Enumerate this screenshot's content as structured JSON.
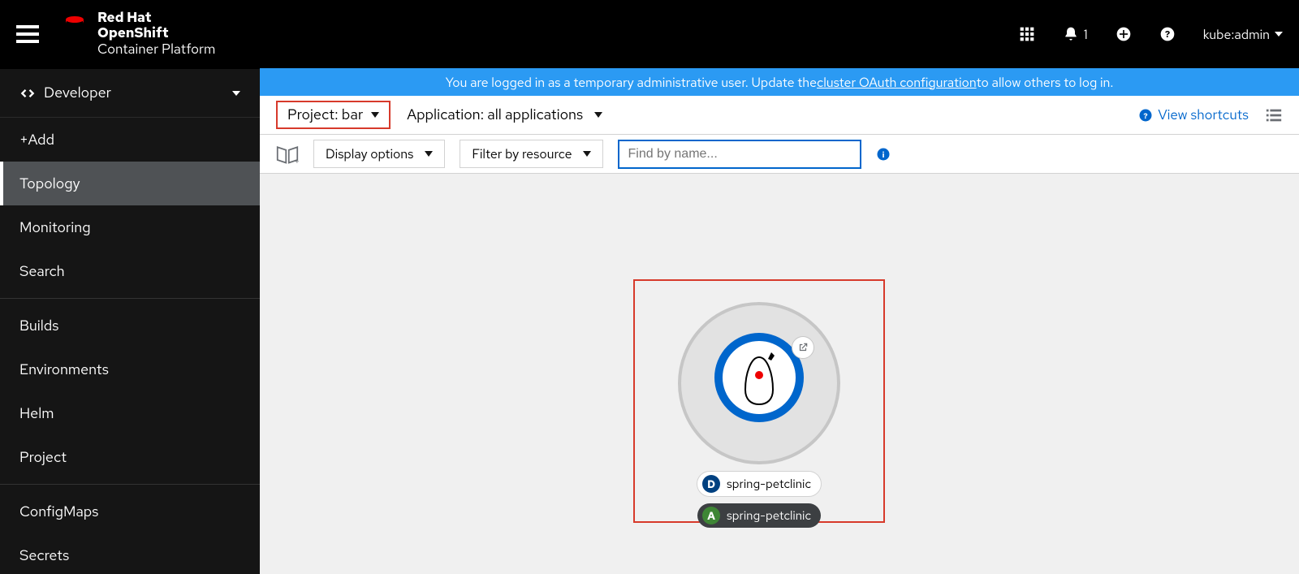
{
  "brand": {
    "line1": "Red Hat",
    "line2": "OpenShift",
    "line3": "Container Platform"
  },
  "header": {
    "notification_count": "1",
    "user_label": "kube:admin"
  },
  "sidebar": {
    "perspective": "Developer",
    "items": [
      "+Add",
      "Topology",
      "Monitoring",
      "Search",
      "Builds",
      "Environments",
      "Helm",
      "Project",
      "ConfigMaps",
      "Secrets"
    ]
  },
  "banner": {
    "pre": "You are logged in as a temporary administrative user. Update the ",
    "link": "cluster OAuth configuration",
    "post": " to allow others to log in."
  },
  "contextbar": {
    "project_label": "Project: bar",
    "application_label": "Application: all applications",
    "shortcuts": "View shortcuts"
  },
  "toolbar": {
    "display_options": "Display options",
    "filter_label": "Filter by resource",
    "search_placeholder": "Find by name..."
  },
  "topology": {
    "deployment_badge": "D",
    "deployment_name": "spring-petclinic",
    "app_badge": "A",
    "app_name": "spring-petclinic"
  }
}
